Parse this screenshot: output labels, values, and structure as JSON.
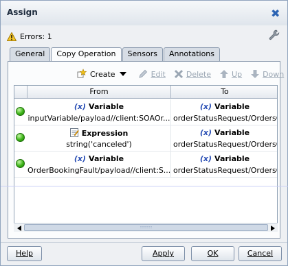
{
  "window": {
    "title": "Assign"
  },
  "errors": {
    "text": "Errors: 1"
  },
  "tabs": [
    {
      "label": "General"
    },
    {
      "label": "Copy Operation"
    },
    {
      "label": "Sensors"
    },
    {
      "label": "Annotations"
    }
  ],
  "toolbar": {
    "create": "Create",
    "edit": "Edit",
    "delete": "Delete",
    "up": "Up",
    "down": "Down"
  },
  "table": {
    "headers": {
      "from": "From",
      "to": "To"
    },
    "rows": [
      {
        "from_type": "Variable",
        "from_value": "inputVariable/payload//client:SOAOr...",
        "to_type": "Variable",
        "to_value": "orderStatusRequest/OrdersCollectio"
      },
      {
        "from_type": "Expression",
        "from_value": "string('canceled')",
        "to_type": "Variable",
        "to_value": "orderStatusRequest/OrdersCollectio"
      },
      {
        "from_type": "Variable",
        "from_value": "OrderBookingFault/payload//client:S...",
        "to_type": "Variable",
        "to_value": "orderStatusRequest/OrdersCollectio"
      }
    ]
  },
  "buttons": {
    "help": "Help",
    "apply": "Apply",
    "ok": "OK",
    "cancel": "Cancel"
  },
  "icons": {
    "variable_glyph": "(x)"
  },
  "colors": {
    "accent": "#2b63b3",
    "status_ok": "#3cb417"
  }
}
